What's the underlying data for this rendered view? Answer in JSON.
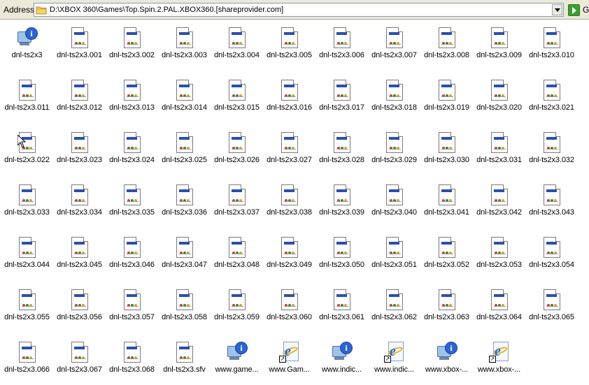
{
  "address_bar": {
    "label": "Address",
    "path": "D:\\XBOX 360\\Games\\Top.Spin.2.PAL.XBOX360.[shareprovider.com]",
    "go_label": "Go"
  },
  "files": [
    {
      "name": "dnl-ts2x3",
      "icon": "info-file-icon"
    },
    {
      "name": "dnl-ts2x3.001",
      "icon": "generic-file-icon"
    },
    {
      "name": "dnl-ts2x3.002",
      "icon": "generic-file-icon"
    },
    {
      "name": "dnl-ts2x3.003",
      "icon": "generic-file-icon"
    },
    {
      "name": "dnl-ts2x3.004",
      "icon": "generic-file-icon"
    },
    {
      "name": "dnl-ts2x3.005",
      "icon": "generic-file-icon"
    },
    {
      "name": "dnl-ts2x3.006",
      "icon": "generic-file-icon"
    },
    {
      "name": "dnl-ts2x3.007",
      "icon": "generic-file-icon"
    },
    {
      "name": "dnl-ts2x3.008",
      "icon": "generic-file-icon"
    },
    {
      "name": "dnl-ts2x3.009",
      "icon": "generic-file-icon"
    },
    {
      "name": "dnl-ts2x3.010",
      "icon": "generic-file-icon"
    },
    {
      "name": "dnl-ts2x3.011",
      "icon": "generic-file-icon"
    },
    {
      "name": "dnl-ts2x3.012",
      "icon": "generic-file-icon"
    },
    {
      "name": "dnl-ts2x3.013",
      "icon": "generic-file-icon"
    },
    {
      "name": "dnl-ts2x3.014",
      "icon": "generic-file-icon"
    },
    {
      "name": "dnl-ts2x3.015",
      "icon": "generic-file-icon"
    },
    {
      "name": "dnl-ts2x3.016",
      "icon": "generic-file-icon"
    },
    {
      "name": "dnl-ts2x3.017",
      "icon": "generic-file-icon"
    },
    {
      "name": "dnl-ts2x3.018",
      "icon": "generic-file-icon"
    },
    {
      "name": "dnl-ts2x3.019",
      "icon": "generic-file-icon"
    },
    {
      "name": "dnl-ts2x3.020",
      "icon": "generic-file-icon"
    },
    {
      "name": "dnl-ts2x3.021",
      "icon": "generic-file-icon"
    },
    {
      "name": "dnl-ts2x3.022",
      "icon": "generic-file-icon"
    },
    {
      "name": "dnl-ts2x3.023",
      "icon": "generic-file-icon"
    },
    {
      "name": "dnl-ts2x3.024",
      "icon": "generic-file-icon"
    },
    {
      "name": "dnl-ts2x3.025",
      "icon": "generic-file-icon"
    },
    {
      "name": "dnl-ts2x3.026",
      "icon": "generic-file-icon"
    },
    {
      "name": "dnl-ts2x3.027",
      "icon": "generic-file-icon"
    },
    {
      "name": "dnl-ts2x3.028",
      "icon": "generic-file-icon"
    },
    {
      "name": "dnl-ts2x3.029",
      "icon": "generic-file-icon"
    },
    {
      "name": "dnl-ts2x3.030",
      "icon": "generic-file-icon"
    },
    {
      "name": "dnl-ts2x3.031",
      "icon": "generic-file-icon"
    },
    {
      "name": "dnl-ts2x3.032",
      "icon": "generic-file-icon"
    },
    {
      "name": "dnl-ts2x3.033",
      "icon": "generic-file-icon"
    },
    {
      "name": "dnl-ts2x3.034",
      "icon": "generic-file-icon"
    },
    {
      "name": "dnl-ts2x3.035",
      "icon": "generic-file-icon"
    },
    {
      "name": "dnl-ts2x3.036",
      "icon": "generic-file-icon"
    },
    {
      "name": "dnl-ts2x3.037",
      "icon": "generic-file-icon"
    },
    {
      "name": "dnl-ts2x3.038",
      "icon": "generic-file-icon"
    },
    {
      "name": "dnl-ts2x3.039",
      "icon": "generic-file-icon"
    },
    {
      "name": "dnl-ts2x3.040",
      "icon": "generic-file-icon"
    },
    {
      "name": "dnl-ts2x3.041",
      "icon": "generic-file-icon"
    },
    {
      "name": "dnl-ts2x3.042",
      "icon": "generic-file-icon"
    },
    {
      "name": "dnl-ts2x3.043",
      "icon": "generic-file-icon"
    },
    {
      "name": "dnl-ts2x3.044",
      "icon": "generic-file-icon"
    },
    {
      "name": "dnl-ts2x3.045",
      "icon": "generic-file-icon"
    },
    {
      "name": "dnl-ts2x3.046",
      "icon": "generic-file-icon"
    },
    {
      "name": "dnl-ts2x3.047",
      "icon": "generic-file-icon"
    },
    {
      "name": "dnl-ts2x3.048",
      "icon": "generic-file-icon"
    },
    {
      "name": "dnl-ts2x3.049",
      "icon": "generic-file-icon"
    },
    {
      "name": "dnl-ts2x3.050",
      "icon": "generic-file-icon"
    },
    {
      "name": "dnl-ts2x3.051",
      "icon": "generic-file-icon"
    },
    {
      "name": "dnl-ts2x3.052",
      "icon": "generic-file-icon"
    },
    {
      "name": "dnl-ts2x3.053",
      "icon": "generic-file-icon"
    },
    {
      "name": "dnl-ts2x3.054",
      "icon": "generic-file-icon"
    },
    {
      "name": "dnl-ts2x3.055",
      "icon": "generic-file-icon"
    },
    {
      "name": "dnl-ts2x3.056",
      "icon": "generic-file-icon"
    },
    {
      "name": "dnl-ts2x3.057",
      "icon": "generic-file-icon"
    },
    {
      "name": "dnl-ts2x3.058",
      "icon": "generic-file-icon"
    },
    {
      "name": "dnl-ts2x3.059",
      "icon": "generic-file-icon"
    },
    {
      "name": "dnl-ts2x3.060",
      "icon": "generic-file-icon"
    },
    {
      "name": "dnl-ts2x3.061",
      "icon": "generic-file-icon"
    },
    {
      "name": "dnl-ts2x3.062",
      "icon": "generic-file-icon"
    },
    {
      "name": "dnl-ts2x3.063",
      "icon": "generic-file-icon"
    },
    {
      "name": "dnl-ts2x3.064",
      "icon": "generic-file-icon"
    },
    {
      "name": "dnl-ts2x3.065",
      "icon": "generic-file-icon"
    },
    {
      "name": "dnl-ts2x3.066",
      "icon": "generic-file-icon"
    },
    {
      "name": "dnl-ts2x3.067",
      "icon": "generic-file-icon"
    },
    {
      "name": "dnl-ts2x3.068",
      "icon": "generic-file-icon"
    },
    {
      "name": "dnl-ts2x3.sfv",
      "icon": "generic-file-icon"
    },
    {
      "name": "www.game...",
      "icon": "info-file-icon"
    },
    {
      "name": "www.Gam...",
      "icon": "ie-shortcut-icon"
    },
    {
      "name": "www.indic...",
      "icon": "info-file-icon"
    },
    {
      "name": "www.indic...",
      "icon": "ie-shortcut-icon"
    },
    {
      "name": "www.xbox-...",
      "icon": "info-file-icon"
    },
    {
      "name": "www.xbox-...",
      "icon": "ie-shortcut-icon"
    }
  ],
  "colors": {
    "toolbar_bg": "#ece9d8",
    "go_green": "#3a9f2f",
    "file_header_blue": "#2a4fb0"
  }
}
